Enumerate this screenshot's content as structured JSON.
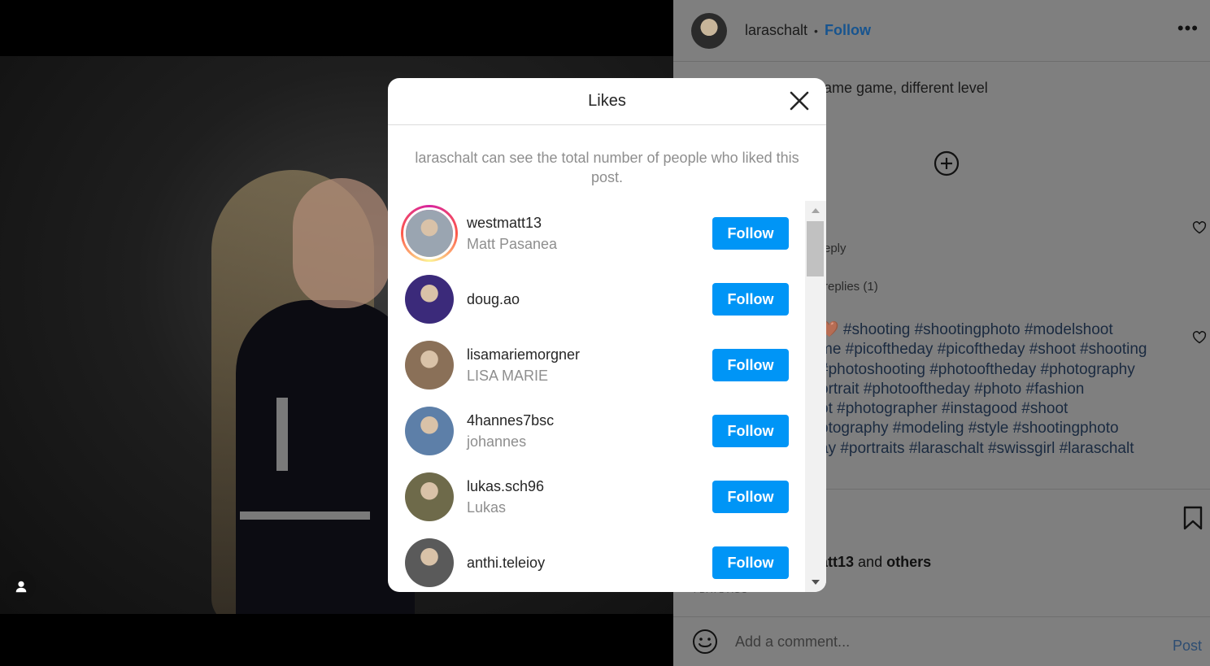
{
  "post": {
    "username": "laraschalt",
    "separator": "•",
    "follow_label": "Follow",
    "more_label": "•••",
    "caption_fragment": "ame game, different level",
    "reply_label": "eply",
    "view_replies_label": "replies (1)",
    "hashtags": "🤎 #shooting #shootingphoto #modelshoot\nme #picoftheday #picoftheday #shoot #shooting\n#photoshooting #photooftheday #photography\nortrait #photooftheday #photo #fashion\not #photographer #instagood #shoot\notography #modeling #style #shootingphoto\nay #portraits #laraschalt #swissgirl #laraschalt",
    "liked_by_user": "att13",
    "liked_by_and": "and",
    "liked_by_others": "others",
    "date": "4 DAYS AGO",
    "comment_placeholder": "Add a comment...",
    "post_label": "Post"
  },
  "modal": {
    "title": "Likes",
    "note": "laraschalt can see the total number of people who liked this post.",
    "likers": [
      {
        "username": "westmatt13",
        "full_name": "Matt Pasanea",
        "follow_label": "Follow",
        "story_ring": true,
        "avatar_color": "#9aa5b1"
      },
      {
        "username": "doug.ao",
        "full_name": "",
        "follow_label": "Follow",
        "story_ring": false,
        "avatar_color": "#3b2a7a"
      },
      {
        "username": "lisamariemorgner",
        "full_name": "LISA MARIE",
        "follow_label": "Follow",
        "story_ring": false,
        "avatar_color": "#8a7058"
      },
      {
        "username": "4hannes7bsc",
        "full_name": "johannes",
        "follow_label": "Follow",
        "story_ring": false,
        "avatar_color": "#5d7fa8"
      },
      {
        "username": "lukas.sch96",
        "full_name": "Lukas",
        "follow_label": "Follow",
        "story_ring": false,
        "avatar_color": "#6e6a4a"
      },
      {
        "username": "anthi.teleioy",
        "full_name": "",
        "follow_label": "Follow",
        "story_ring": false,
        "avatar_color": "#5a5a5a"
      }
    ]
  },
  "colors": {
    "follow_button": "#0095f6",
    "link": "#0095f6"
  }
}
